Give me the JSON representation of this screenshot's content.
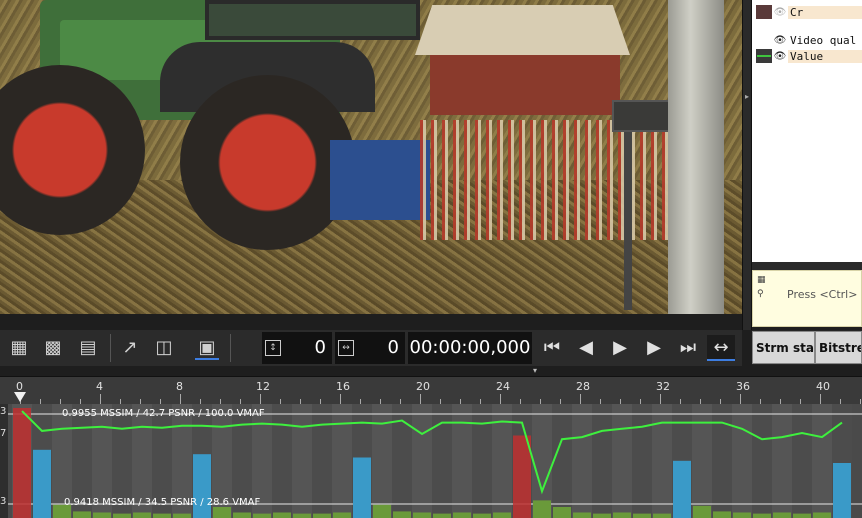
{
  "legend": {
    "items": [
      {
        "label": "Cr",
        "swatch": "#5a3a3a",
        "visibility": "hidden-eye"
      },
      {
        "label": "Video qual",
        "swatch": "",
        "visibility": "eye"
      },
      {
        "label": "Value",
        "swatch": "#3ec43e",
        "visibility": "eye"
      }
    ]
  },
  "hint": {
    "text": "Press <Ctrl> ke"
  },
  "tabs": [
    {
      "label": "Strm stats"
    },
    {
      "label": "Bitstrea"
    }
  ],
  "toolbar": {
    "frame_counter": "0",
    "offset_counter": "0",
    "timecode": "00:00:00,000"
  },
  "ruler": {
    "ticks": [
      "0",
      "4",
      "8",
      "12",
      "16",
      "20",
      "24",
      "28",
      "32",
      "36",
      "40"
    ]
  },
  "graph": {
    "ref_top_label": "0.9955 MSSIM / 42.7 PSNR / 100.0 VMAF",
    "ref_bottom_label": "0.9418 MSSIM / 34.5 PSNR / 28.6 VMAF",
    "y_labels": [
      "3",
      "7",
      "3"
    ],
    "colors": {
      "i_frame": "#c03030",
      "p_frame": "#3a9ac8",
      "b_frame": "#6a9a3a",
      "quality_line": "#3ef03e"
    }
  },
  "chart_data": {
    "type": "bar",
    "x": [
      0,
      1,
      2,
      3,
      4,
      5,
      6,
      7,
      8,
      9,
      10,
      11,
      12,
      13,
      14,
      15,
      16,
      17,
      18,
      19,
      20,
      21,
      22,
      23,
      24,
      25,
      26,
      27,
      28,
      29,
      30,
      31,
      32,
      33,
      34,
      35,
      36,
      37,
      38,
      39,
      40,
      41
    ],
    "frame_type": [
      "I",
      "P",
      "B",
      "B",
      "B",
      "B",
      "B",
      "B",
      "B",
      "P",
      "B",
      "B",
      "B",
      "B",
      "B",
      "B",
      "B",
      "P",
      "B",
      "B",
      "B",
      "B",
      "B",
      "B",
      "B",
      "I",
      "B",
      "B",
      "B",
      "B",
      "B",
      "B",
      "B",
      "P",
      "B",
      "B",
      "B",
      "B",
      "B",
      "B",
      "B",
      "P"
    ],
    "frame_size": [
      100,
      62,
      12,
      6,
      5,
      4,
      5,
      4,
      4,
      58,
      10,
      5,
      4,
      5,
      4,
      4,
      5,
      55,
      12,
      6,
      5,
      4,
      5,
      4,
      5,
      75,
      16,
      10,
      5,
      4,
      5,
      4,
      4,
      52,
      11,
      6,
      5,
      4,
      5,
      4,
      5,
      50
    ],
    "series": [
      {
        "name": "Value",
        "values": [
          97,
          78,
          80,
          81,
          82,
          80,
          82,
          81,
          83,
          83,
          82,
          84,
          85,
          84,
          82,
          84,
          85,
          86,
          85,
          88,
          75,
          86,
          86,
          85,
          87,
          86,
          20,
          70,
          72,
          78,
          80,
          82,
          86,
          86,
          86,
          86,
          80,
          70,
          72,
          76,
          72,
          86
        ]
      }
    ],
    "ylim": [
      0,
      100
    ]
  }
}
